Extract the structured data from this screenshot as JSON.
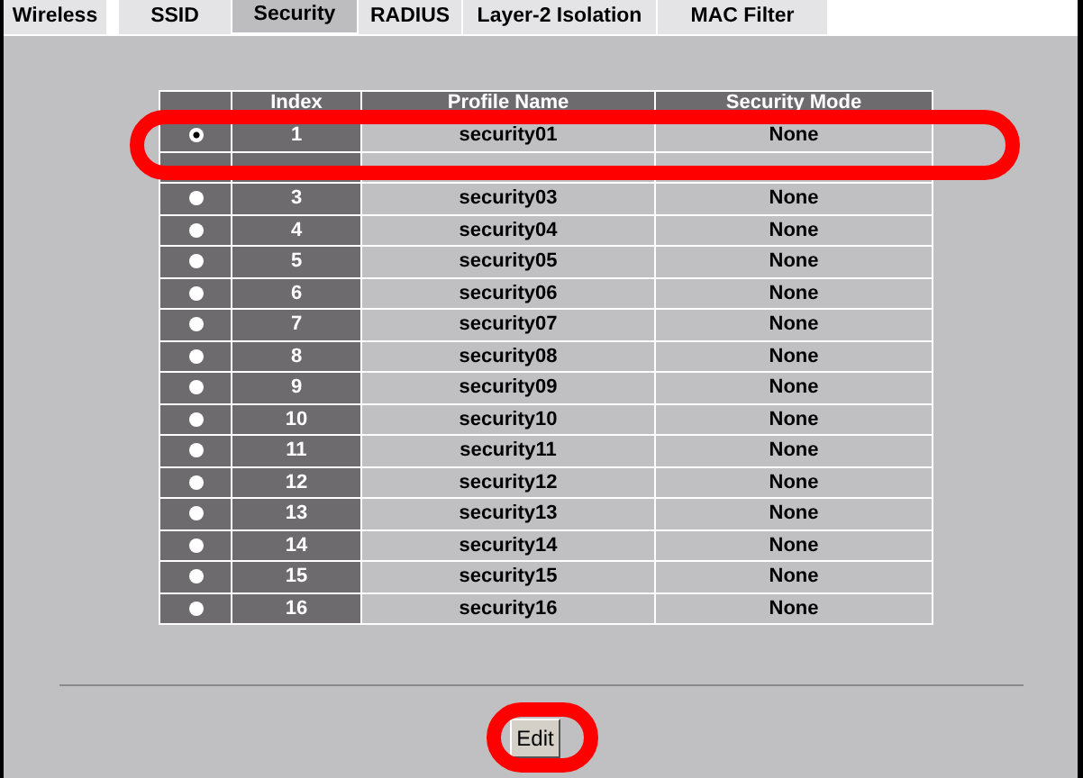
{
  "tabs": [
    {
      "label": "Wireless",
      "selected": false
    },
    {
      "label": "SSID",
      "selected": false
    },
    {
      "label": "Security",
      "selected": true
    },
    {
      "label": "RADIUS",
      "selected": false
    },
    {
      "label": "Layer-2 Isolation",
      "selected": false
    },
    {
      "label": "MAC Filter",
      "selected": false
    }
  ],
  "table": {
    "columns": [
      "Index",
      "Profile Name",
      "Security Mode"
    ],
    "rows": [
      {
        "selected": true,
        "index": "1",
        "profile_name": "security01",
        "security_mode": "None"
      },
      {},
      {
        "selected": false,
        "index": "3",
        "profile_name": "security03",
        "security_mode": "None"
      },
      {
        "selected": false,
        "index": "4",
        "profile_name": "security04",
        "security_mode": "None"
      },
      {
        "selected": false,
        "index": "5",
        "profile_name": "security05",
        "security_mode": "None"
      },
      {
        "selected": false,
        "index": "6",
        "profile_name": "security06",
        "security_mode": "None"
      },
      {
        "selected": false,
        "index": "7",
        "profile_name": "security07",
        "security_mode": "None"
      },
      {
        "selected": false,
        "index": "8",
        "profile_name": "security08",
        "security_mode": "None"
      },
      {
        "selected": false,
        "index": "9",
        "profile_name": "security09",
        "security_mode": "None"
      },
      {
        "selected": false,
        "index": "10",
        "profile_name": "security10",
        "security_mode": "None"
      },
      {
        "selected": false,
        "index": "11",
        "profile_name": "security11",
        "security_mode": "None"
      },
      {
        "selected": false,
        "index": "12",
        "profile_name": "security12",
        "security_mode": "None"
      },
      {
        "selected": false,
        "index": "13",
        "profile_name": "security13",
        "security_mode": "None"
      },
      {
        "selected": false,
        "index": "14",
        "profile_name": "security14",
        "security_mode": "None"
      },
      {
        "selected": false,
        "index": "15",
        "profile_name": "security15",
        "security_mode": "None"
      },
      {
        "selected": false,
        "index": "16",
        "profile_name": "security16",
        "security_mode": "None"
      }
    ]
  },
  "edit_button": "Edit"
}
